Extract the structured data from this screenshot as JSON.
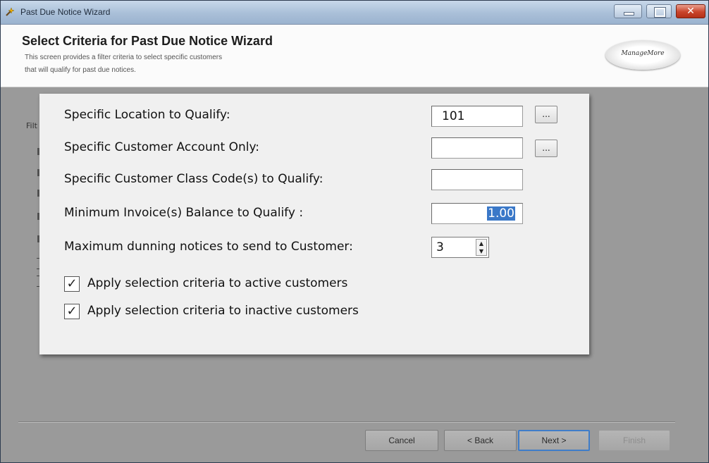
{
  "window": {
    "title": "Past Due Notice Wizard"
  },
  "header": {
    "title": "Select Criteria for Past Due Notice Wizard",
    "description": "This screen provides a filter criteria to select specific customers\nthat will qualify for past due notices.",
    "logo_text": "ManageMore"
  },
  "background": {
    "label": "Filt"
  },
  "form": {
    "location_label": "Specific Location to Qualify:",
    "location_value": "101",
    "account_label": "Specific Customer Account Only:",
    "account_value": "",
    "class_label": "Specific Customer Class Code(s) to Qualify:",
    "class_value": "",
    "min_balance_label": "Minimum Invoice(s) Balance to Qualify :",
    "min_balance_value": "1.00",
    "max_notices_label": "Maximum dunning notices to send to Customer:",
    "max_notices_value": "3",
    "lookup_label": "...",
    "active_label": "Apply selection criteria to active customers",
    "active_checked": true,
    "inactive_label": "Apply selection criteria to inactive customers",
    "inactive_checked": true
  },
  "buttons": {
    "cancel": "Cancel",
    "back": "< Back",
    "next": "Next >",
    "finish": "Finish"
  }
}
